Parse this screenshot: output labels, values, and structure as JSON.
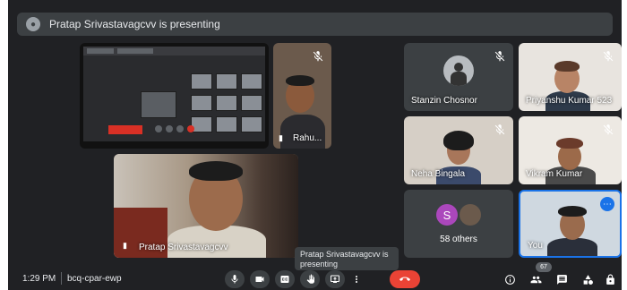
{
  "banner": {
    "text": "Pratap Srivastavagcvv is presenting"
  },
  "participants": {
    "rahul": {
      "name": "Rahu..."
    },
    "pratap": {
      "name": "Pratap Srivastavagcvv"
    },
    "stanzin": {
      "name": "Stanzin Chosnor"
    },
    "priyanshu": {
      "name": "Priyanshu Kumar 523"
    },
    "neha": {
      "name": "Neha Bingala"
    },
    "vikram": {
      "name": "Vikram Kumar"
    },
    "others": {
      "initial": "S",
      "label": "58 others"
    },
    "you": {
      "name": "You"
    }
  },
  "tooltip": {
    "text": "Pratap Srivastavagcvv is presenting"
  },
  "bottom_bar": {
    "time": "1:29 PM",
    "meeting_code": "bcq-cpar-ewp",
    "participant_count": "67"
  },
  "colors": {
    "background": "#202124",
    "tile": "#3c4043",
    "end_call": "#ea4335",
    "accent": "#1a73e8"
  }
}
